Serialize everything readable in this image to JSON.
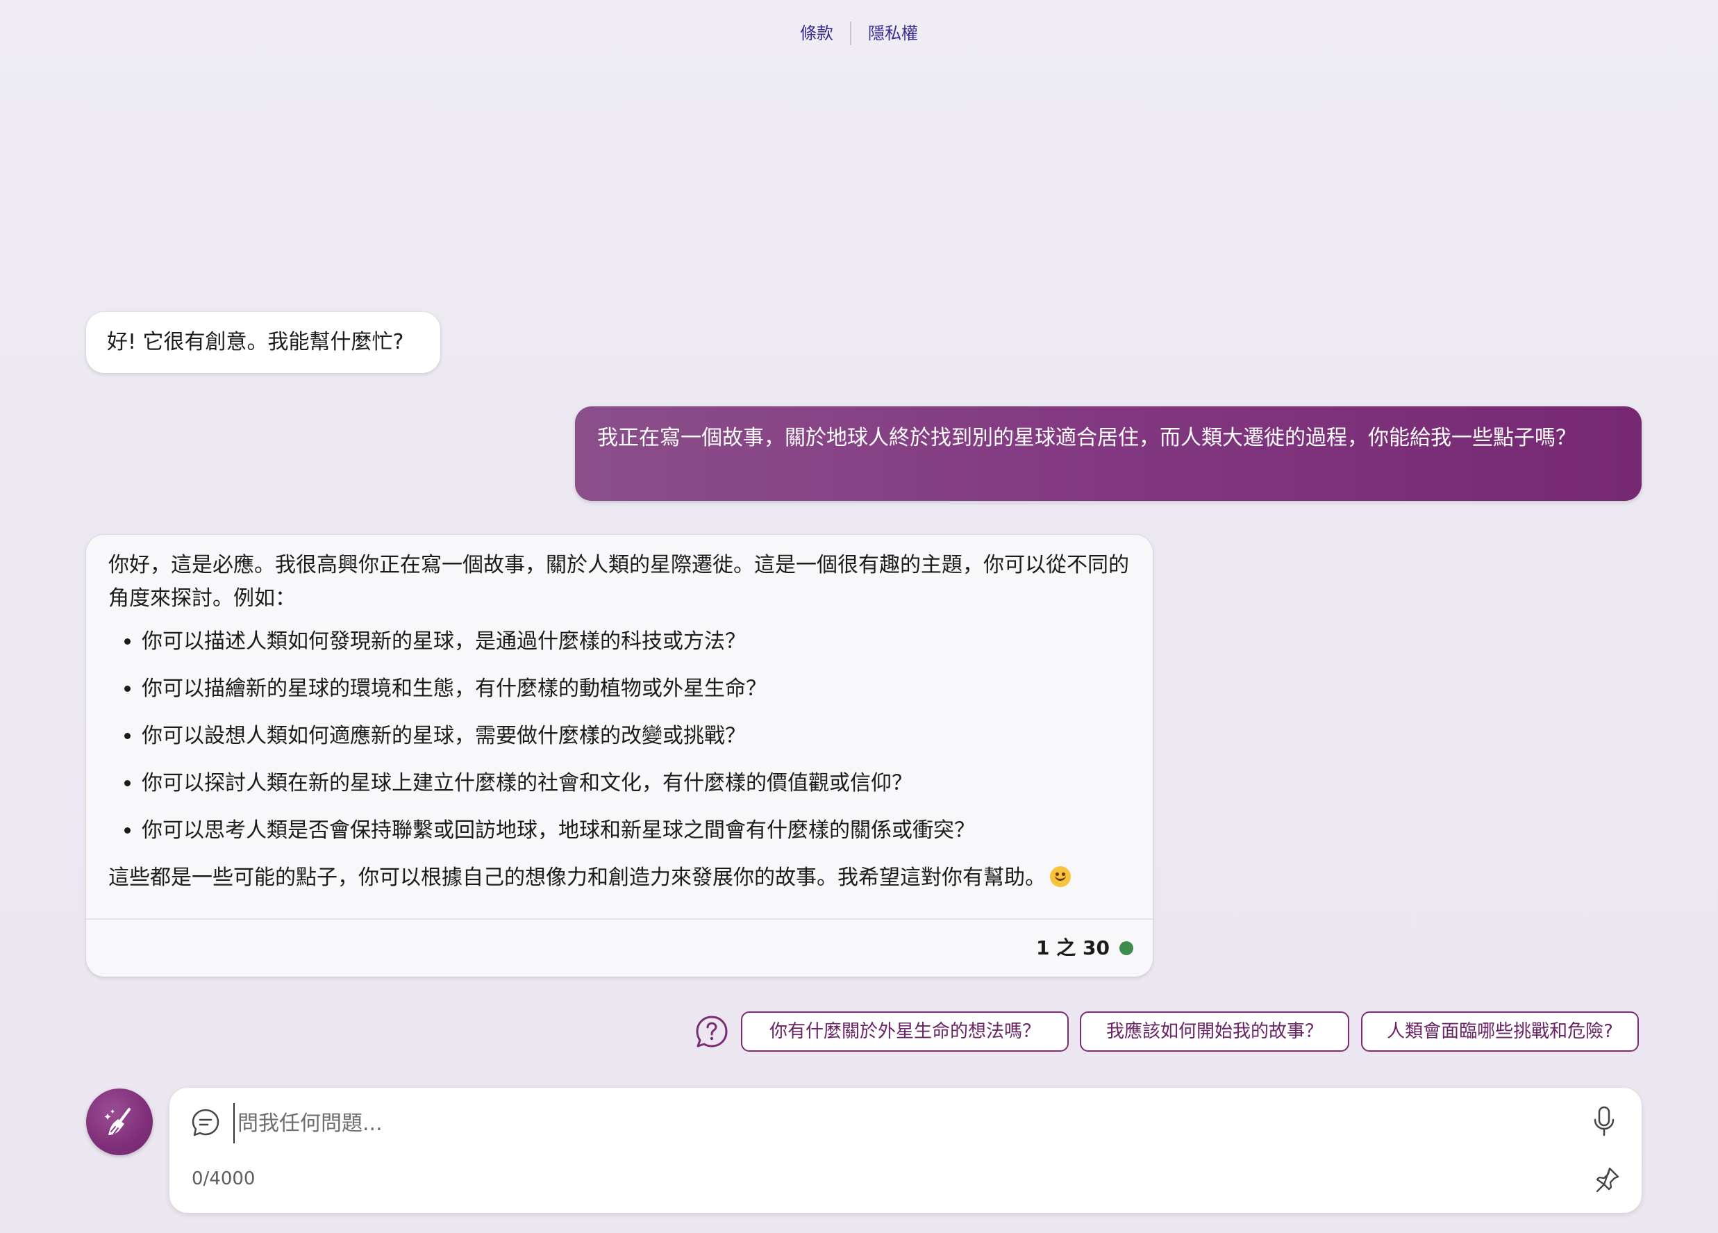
{
  "header": {
    "terms_label": "條款",
    "privacy_label": "隱私權"
  },
  "conversation": {
    "greeting": "好! 它很有創意。我能幫什麼忙?",
    "user_message": "我正在寫一個故事，關於地球人終於找到別的星球適合居住，而人類大遷徙的過程，你能給我一些點子嗎？",
    "answer": {
      "intro": "你好，這是必應。我很高興你正在寫一個故事，關於人類的星際遷徙。這是一個很有趣的主題，你可以從不同的角度來探討。例如：",
      "bullets": [
        "你可以描述人類如何發現新的星球，是通過什麼樣的科技或方法？",
        "你可以描繪新的星球的環境和生態，有什麼樣的動植物或外星生命？",
        "你可以設想人類如何適應新的星球，需要做什麼樣的改變或挑戰？",
        "你可以探討人類在新的星球上建立什麼樣的社會和文化，有什麼樣的價值觀或信仰？",
        "你可以思考人類是否會保持聯繫或回訪地球，地球和新星球之間會有什麼樣的關係或衝突？"
      ],
      "outro": "這些都是一些可能的點子，你可以根據自己的想像力和創造力來發展你的故事。我希望這對你有幫助。",
      "emoji_icon": "smiling-face-emoji",
      "turn_counter": "1 之 30",
      "status_color": "#3e8b4e"
    }
  },
  "suggestions": [
    "你有什麼關於外星生命的想法嗎？",
    "我應該如何開始我的故事？",
    "人類會面臨哪些挑戰和危險?"
  ],
  "composer": {
    "placeholder": "問我任何問題...",
    "value": "",
    "char_count": "0/4000",
    "new_topic_icon": "broom-icon",
    "accent_color": "#7f2f79"
  }
}
